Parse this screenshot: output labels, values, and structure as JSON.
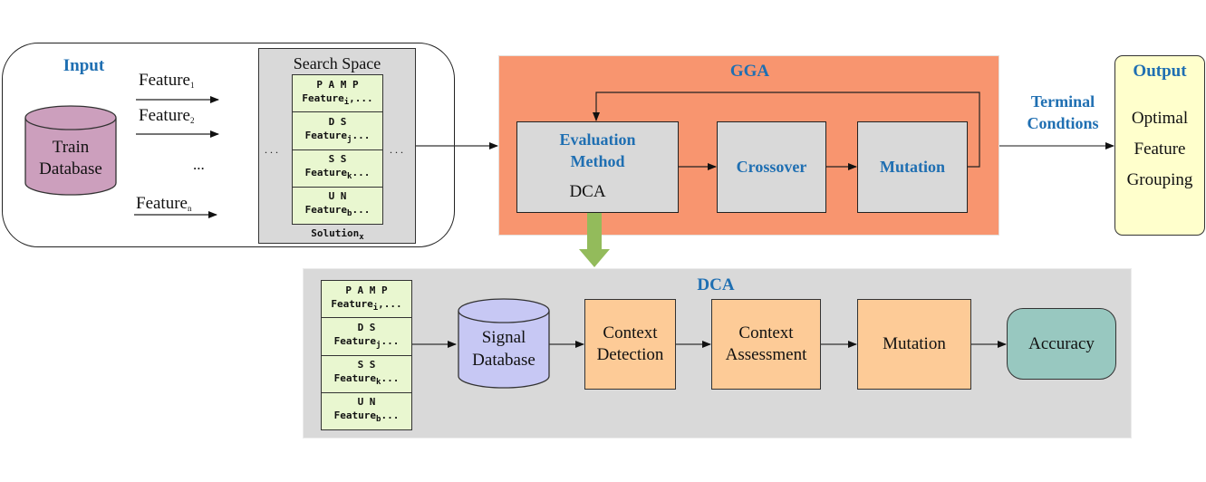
{
  "input_panel": {
    "title": "Input",
    "database_label_line1": "Train",
    "database_label_line2": "Database",
    "features": [
      {
        "name": "Feature",
        "sub": "1"
      },
      {
        "name": "Feature",
        "sub": "2"
      },
      {
        "name": "...",
        "sub": ""
      },
      {
        "name": "Feature",
        "sub": "n"
      }
    ]
  },
  "search_space": {
    "title": "Search Space",
    "left_dots": ". . .",
    "right_dots": ". . .",
    "cells": [
      {
        "group": "P A M P",
        "feature": "Feature",
        "sub": "i",
        "tail": ",..."
      },
      {
        "group": "D S",
        "feature": "Feature",
        "sub": "j",
        "tail": "..."
      },
      {
        "group": "S S",
        "feature": "Feature",
        "sub": "k",
        "tail": "..."
      },
      {
        "group": "U N",
        "feature": "Feature",
        "sub": "b",
        "tail": "..."
      }
    ],
    "solution_label": "Solution",
    "solution_sub": "x"
  },
  "gga": {
    "title": "GGA",
    "evaluation": {
      "line1": "Evaluation",
      "line2": "Method",
      "method": "DCA"
    },
    "crossover": "Crossover",
    "mutation": "Mutation"
  },
  "terminal": {
    "line1": "Terminal",
    "line2": "Condtions"
  },
  "output": {
    "title": "Output",
    "line1": "Optimal",
    "line2": "Feature",
    "line3": "Grouping"
  },
  "dca": {
    "title": "DCA",
    "cells": [
      {
        "group": "P A M P",
        "feature": "Feature",
        "sub": "i",
        "tail": ",..."
      },
      {
        "group": "D S",
        "feature": "Feature",
        "sub": "j",
        "tail": "..."
      },
      {
        "group": "S S",
        "feature": "Feature",
        "sub": "k",
        "tail": "..."
      },
      {
        "group": "U N",
        "feature": "Feature",
        "sub": "b",
        "tail": "..."
      }
    ],
    "signal_db_line1": "Signal",
    "signal_db_line2": "Database",
    "context_detection_line1": "Context",
    "context_detection_line2": "Detection",
    "context_assessment_line1": "Context",
    "context_assessment_line2": "Assessment",
    "mutation": "Mutation",
    "accuracy": "Accuracy"
  },
  "colors": {
    "title_blue": "#1f6fb2",
    "gga_fill": "#f8956f",
    "gray_box": "#d9d9d9",
    "solution_fill": "#e9f7d0",
    "train_db": "#cc9fbd",
    "signal_db": "#c7c8f4",
    "dca_step": "#fdcb97",
    "accuracy": "#98c8c0",
    "output_fill": "#ffffcc",
    "down_arrow": "#93bb5b"
  }
}
